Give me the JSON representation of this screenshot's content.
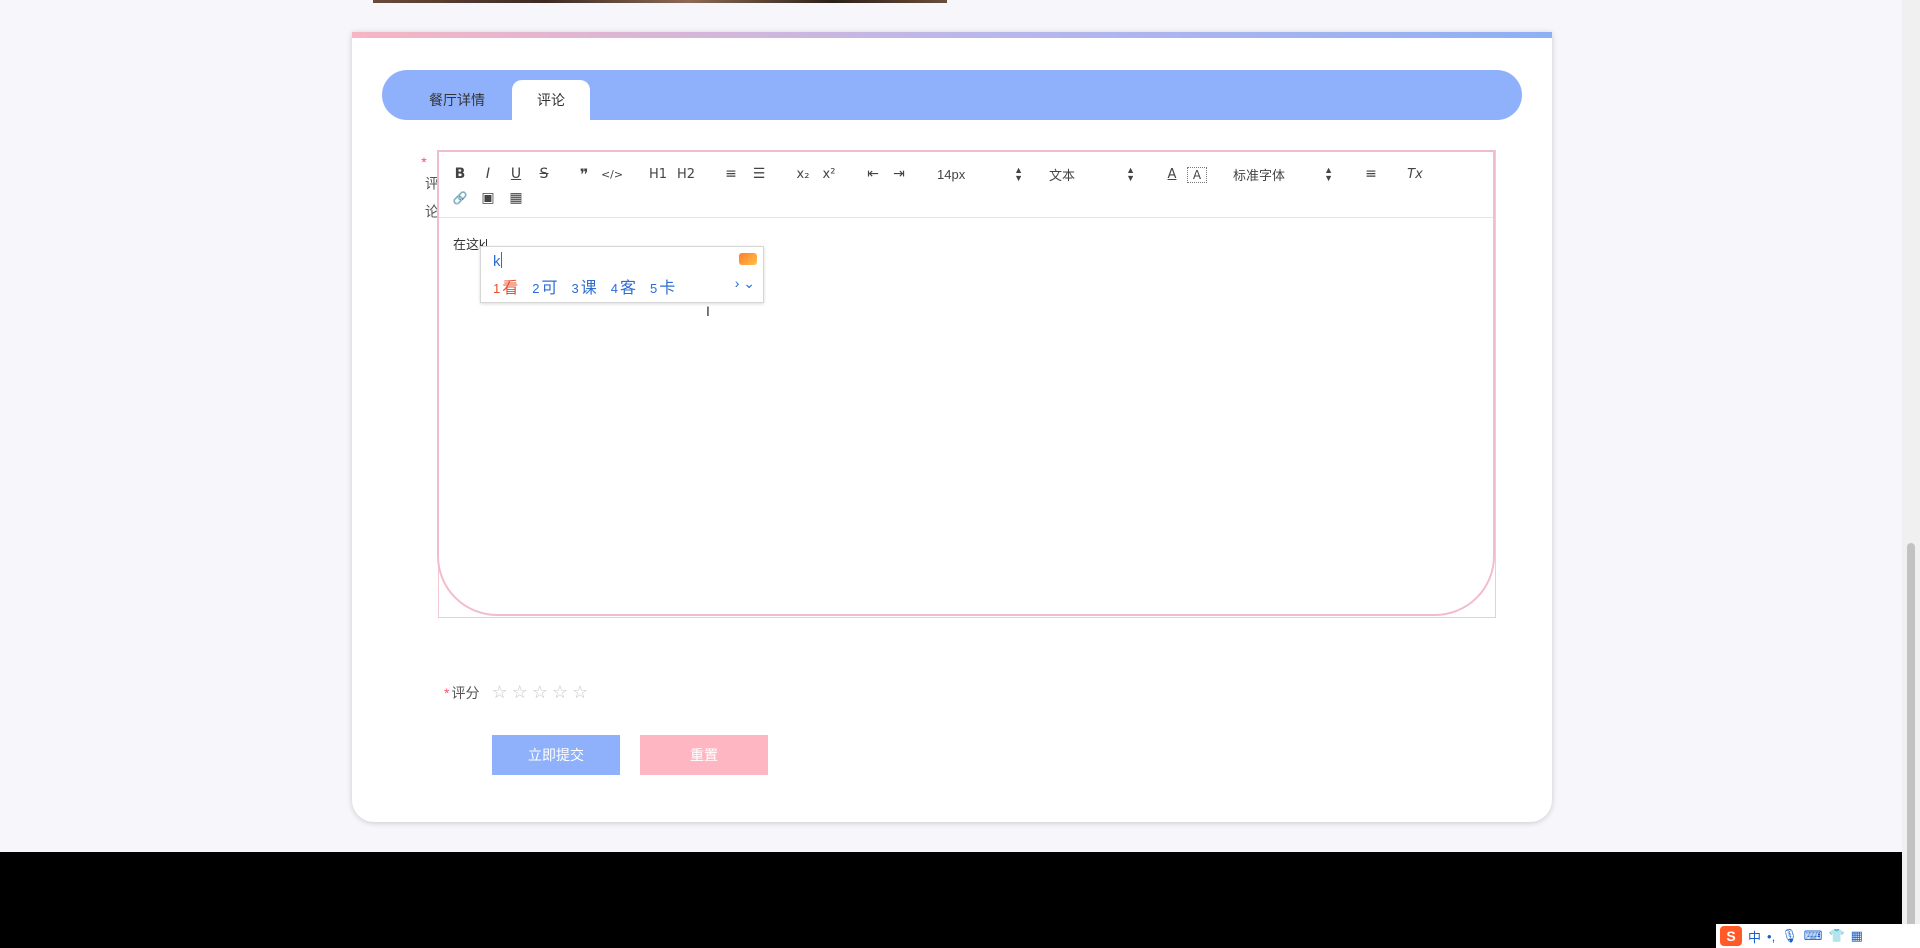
{
  "tabs": {
    "detail_label": "餐厅详情",
    "comment_label": "评论"
  },
  "form": {
    "comment_label": "评论",
    "required_mark": "*",
    "rating_label": "评分",
    "rating_stars": 5,
    "rating_value": 0
  },
  "toolbar": {
    "bold": "B",
    "italic": "I",
    "underline": "U",
    "strike": "S",
    "blockquote": "❞",
    "code": "</>",
    "h1": "H1",
    "h2": "H2",
    "ordered_list": "≡",
    "bullet_list": "☰",
    "subscript": "x₂",
    "superscript": "x²",
    "outdent": "⇤",
    "indent": "⇥",
    "size": "14px",
    "header": "文本",
    "font": "标准字体",
    "align": "≡",
    "clean": "Tx",
    "text_color": "A",
    "background_color": "A",
    "link": "🔗",
    "image": "▣",
    "video": "▦"
  },
  "editor": {
    "content": "在这k"
  },
  "ime": {
    "input": "k",
    "candidates": [
      {
        "num": "1",
        "text": "看"
      },
      {
        "num": "2",
        "text": "可"
      },
      {
        "num": "3",
        "text": "课"
      },
      {
        "num": "4",
        "text": "客"
      },
      {
        "num": "5",
        "text": "卡"
      }
    ],
    "more": "› ⌄"
  },
  "buttons": {
    "submit": "立即提交",
    "reset": "重置"
  },
  "tray": {
    "ime_logo": "S",
    "mode": "中",
    "punct": "•,"
  },
  "colors": {
    "accent_blue": "#8fb1fb",
    "accent_pink": "#ffb6c3",
    "required_red": "#ff4d6b"
  }
}
